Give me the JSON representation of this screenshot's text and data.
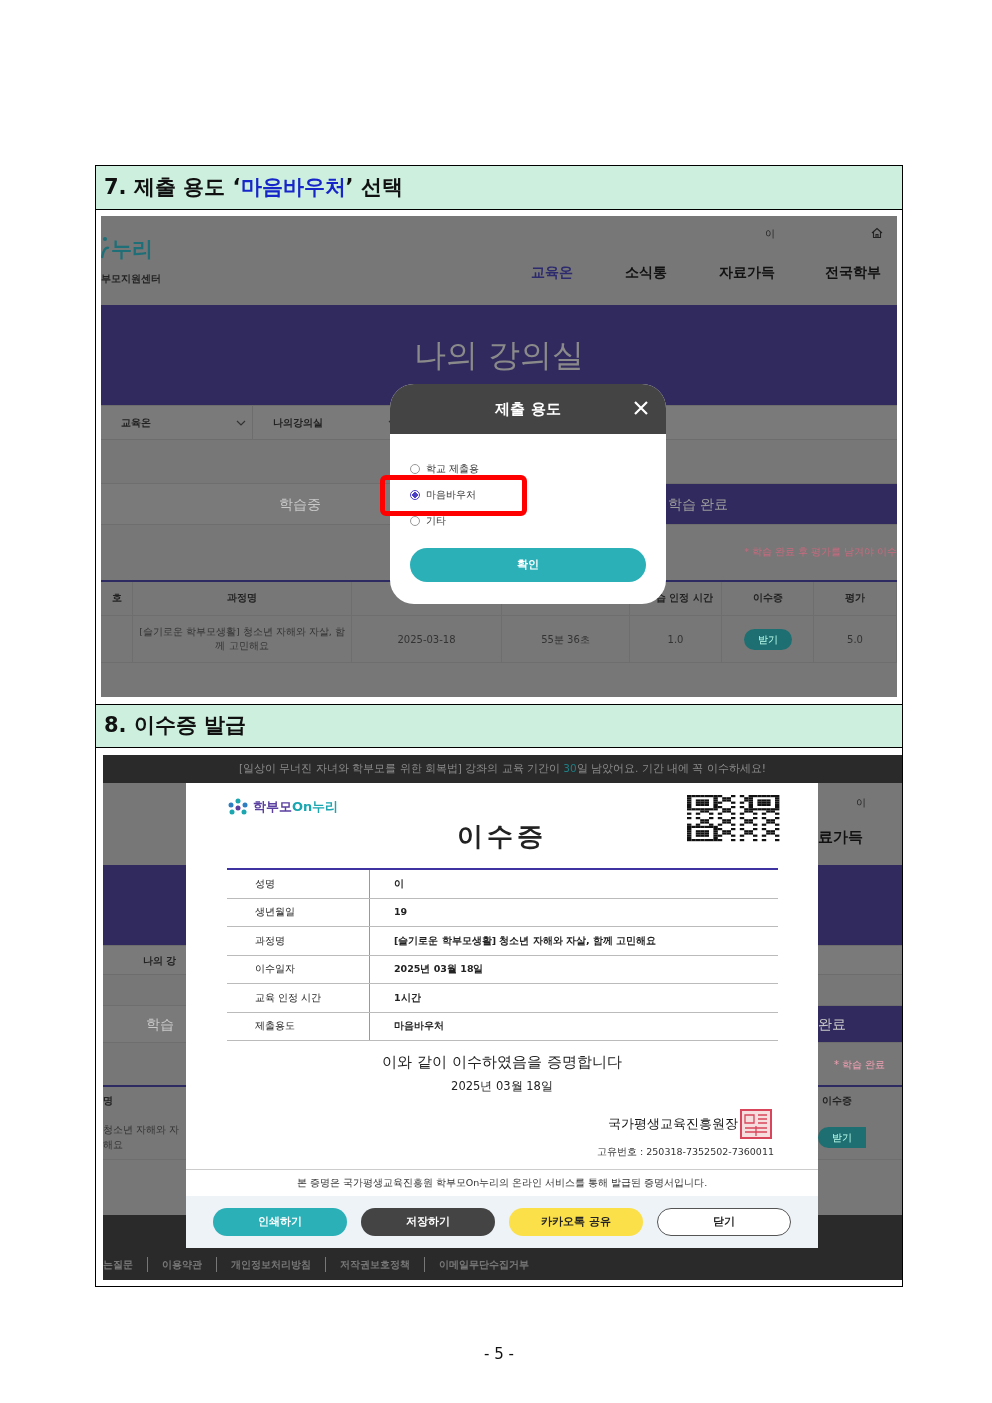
{
  "section_7": {
    "heading": {
      "before": "7. 제출 용도 ‘",
      "highlight": "마음바우처",
      "after": "’ 선택"
    },
    "screenshot": {
      "header": {
        "logo_text": "누리",
        "logo_subtitle": "부모지원센터",
        "util_text": "이",
        "nav": [
          {
            "label": "교육온",
            "selected": true
          },
          {
            "label": "소식통",
            "selected": false
          },
          {
            "label": "자료가득",
            "selected": false
          },
          {
            "label": "전국학부",
            "selected": false
          }
        ]
      },
      "banner_title": "나의 강의실",
      "breadcrumbs": [
        "교육온",
        "나의강의실"
      ],
      "tabs": [
        {
          "label": "학습중",
          "selected": false
        },
        {
          "label": "학습 완료",
          "selected": true
        }
      ],
      "note": "* 학습 완료 후 평가를 남겨야 이수",
      "table": {
        "columns": [
          "호",
          "과정명",
          "습 인정 시간",
          "이수증",
          "평가"
        ],
        "row": {
          "course": "[슬기로운 학부모생활] 청소년 자해와 자살, 함께 고민해요",
          "date": "2025-03-18",
          "duration": "55분 36초",
          "hours": "1.0",
          "certificate_button": "받기",
          "rating": "5.0"
        }
      },
      "modal": {
        "title": "제출 용도",
        "options": [
          {
            "label": "학교 제출용",
            "selected": false,
            "highlighted": false
          },
          {
            "label": "마음바우처",
            "selected": true,
            "highlighted": true
          },
          {
            "label": "기타",
            "selected": false,
            "highlighted": false
          }
        ],
        "confirm": "확인"
      }
    }
  },
  "section_8": {
    "heading": "8. 이수증 발급",
    "screenshot": {
      "notice": {
        "before": "[일상이 무너진 자녀와 학부모를 위한 회복법] 강좌의 교육 기간이 ",
        "highlight": "30",
        "after": "일 남았어요. 기간 내에 꼭 이수하세요!"
      },
      "left_strip": {
        "breadcrumb": "나의 강",
        "tab": "학습",
        "column": "명",
        "row_lines": [
          "청소년 자해와 자",
          "해요"
        ]
      },
      "right_strip": {
        "util_text": "이",
        "nav": "료가득",
        "tab": "완료",
        "note": "* 학습 완료",
        "column": "이수증",
        "button": "받기"
      },
      "certificate": {
        "logo": {
          "part1": "학부모",
          "part2": "On누리"
        },
        "title": "이수증",
        "fields": [
          {
            "label": "성명",
            "value": "이"
          },
          {
            "label": "생년월일",
            "value": "19"
          },
          {
            "label": "과정명",
            "value": "[슬기로운 학부모생활] 청소년 자해와 자살, 함께 고민해요"
          },
          {
            "label": "이수일자",
            "value": "2025년 03월 18일"
          },
          {
            "label": "교육 인정 시간",
            "value": "1시간"
          },
          {
            "label": "제출용도",
            "value": "마음바우처"
          }
        ],
        "statement": "이와 같이 이수하였음을 증명합니다",
        "date": "2025년 03월 18일",
        "issuer": "국가평생교육진흥원장",
        "serial": "고유번호 : 250318-7352502-7360011",
        "disclaimer": "본 증명은 국가평생교육진흥원 학부모On누리의 온라인 서비스를 통해 발급된 증명서입니다.",
        "buttons": [
          {
            "label": "인쇄하기",
            "kind": "print"
          },
          {
            "label": "저장하기",
            "kind": "save"
          },
          {
            "label": "카카오톡 공유",
            "kind": "share"
          },
          {
            "label": "닫기",
            "kind": "close"
          }
        ]
      },
      "footer_links": [
        "는질문",
        "이용약관",
        "개인정보처리방침",
        "저작권보호정책",
        "이메일무단수집거부"
      ]
    }
  },
  "page_number": "- 5 -"
}
